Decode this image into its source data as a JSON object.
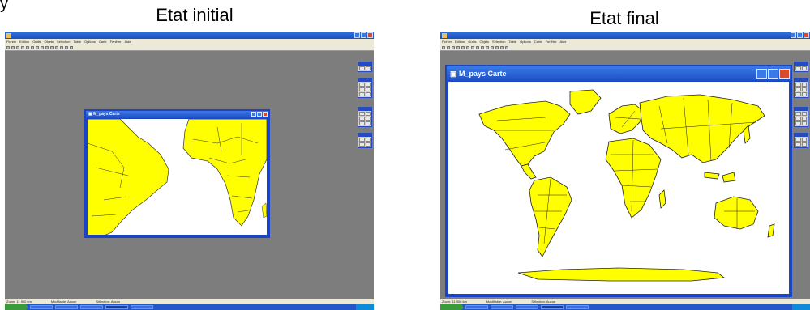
{
  "corner_label": "y",
  "left": {
    "caption": "Etat initial",
    "map_window": {
      "title": "M_pays Carte"
    },
    "menu_items": [
      "Fichier",
      "Edition",
      "Outils",
      "Objets",
      "Sélection",
      "Table",
      "Options",
      "Carte",
      "Fenêtre",
      "Aide"
    ],
    "status": [
      "Zoom: 11 900 km",
      "Modifiable: Aucun",
      "Sélection: Aucun"
    ]
  },
  "right": {
    "caption": "Etat final",
    "map_window": {
      "title": "M_pays Carte"
    },
    "menu_items": [
      "Fichier",
      "Edition",
      "Outils",
      "Objets",
      "Sélection",
      "Table",
      "Options",
      "Carte",
      "Fenêtre",
      "Aide"
    ],
    "status": [
      "Zoom: 11 900 km",
      "Modifiable: Aucun",
      "Sélection: Aucun"
    ]
  },
  "colors": {
    "land": "#ffff00",
    "desktop": "#7d7d7d",
    "window_blue": "#1b44c4"
  }
}
